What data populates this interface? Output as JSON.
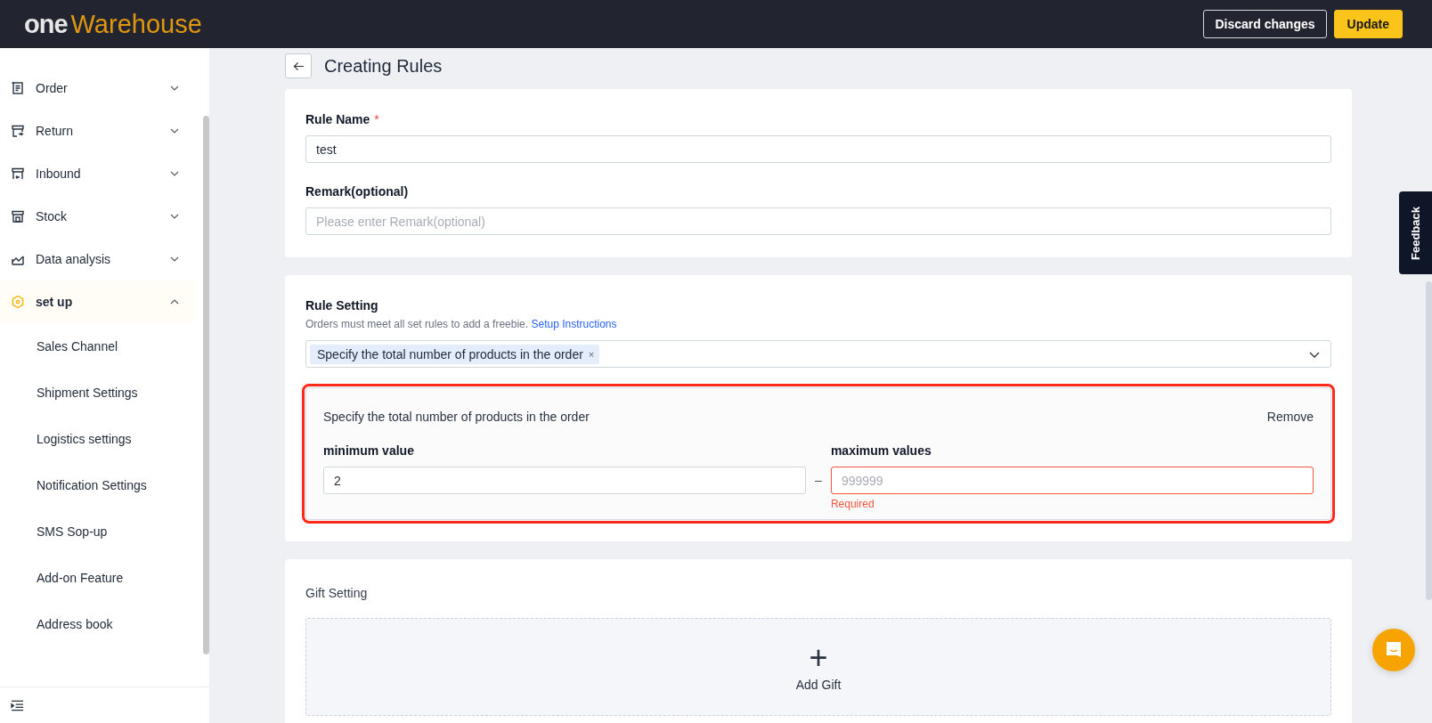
{
  "header": {
    "logo": {
      "part_1": "one",
      "part_2": "Warehouse"
    },
    "buttons": [
      {
        "label": "Discard changes",
        "kind": "outline"
      },
      {
        "label": "Update",
        "kind": "primary"
      }
    ]
  },
  "sidebar": {
    "items": [
      {
        "label": "Order",
        "selected": false,
        "expanded": false
      },
      {
        "label": "Return",
        "selected": false,
        "expanded": false
      },
      {
        "label": "Inbound",
        "selected": false,
        "expanded": false
      },
      {
        "label": "Stock",
        "selected": false,
        "expanded": false
      },
      {
        "label": "Data analysis",
        "selected": false,
        "expanded": false
      },
      {
        "label": "set up",
        "selected": true,
        "expanded": true,
        "children": [
          {
            "label": "Sales Channel"
          },
          {
            "label": "Shipment Settings"
          },
          {
            "label": "Logistics settings"
          },
          {
            "label": "Notification Settings"
          },
          {
            "label": "SMS Sop-up"
          },
          {
            "label": "Add-on Feature"
          },
          {
            "label": "Address book"
          }
        ]
      }
    ]
  },
  "page": {
    "title": "Creating Rules"
  },
  "basic": {
    "rule_name": {
      "label": "Rule Name",
      "required": true,
      "required_mark": "*",
      "value": "test"
    },
    "remark": {
      "label": "Remark(optional)",
      "placeholder": "Please enter Remark(optional)"
    }
  },
  "rule_setting": {
    "title": "Rule Setting",
    "description": "Orders must meet all set rules to add a freebie.",
    "link": "Setup Instructions",
    "selected_tags": [
      {
        "label": "Specify the total number of products in the order",
        "close": "×"
      }
    ],
    "rules": [
      {
        "title": "Specify the total number of products in the order",
        "remove": "Remove",
        "invalid": true,
        "minimum": {
          "label": "minimum value",
          "value": "2",
          "error": false
        },
        "separator": "–",
        "maximum": {
          "label": "maximum values",
          "placeholder": "999999",
          "error": true,
          "message": "Required"
        }
      }
    ]
  },
  "gift_setting": {
    "title": "Gift Setting",
    "add": {
      "icon": "+",
      "label": "Add Gift"
    }
  },
  "feedback": {
    "label": "Feedback"
  }
}
